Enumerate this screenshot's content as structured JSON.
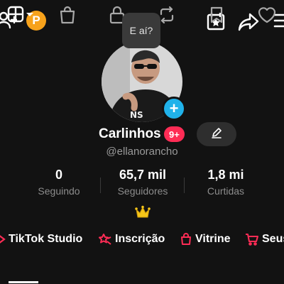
{
  "topbar": {
    "points_badge": "P",
    "icons": [
      "add-user-icon",
      "calendar-star-icon",
      "share-icon",
      "menu-icon"
    ]
  },
  "bubble": {
    "text": "E aí?"
  },
  "profile": {
    "name": "Carlinhos",
    "notifications": "9+",
    "username": "@ellanorancho"
  },
  "stats": [
    {
      "value": "0",
      "label": "Seguindo"
    },
    {
      "value": "65,7 mil",
      "label": "Seguidores"
    },
    {
      "value": "1,8 mi",
      "label": "Curtidas"
    }
  ],
  "shortcuts": [
    {
      "label": "TikTok Studio",
      "icon": "studio-icon"
    },
    {
      "label": "Inscrição",
      "icon": "subscription-icon"
    },
    {
      "label": "Vitrine",
      "icon": "shop-bag-icon"
    },
    {
      "label": "Seus",
      "icon": "cart-icon"
    }
  ],
  "tabs": [
    "grid-tab",
    "shop-tab",
    "private-tab",
    "reposts-tab",
    "favorites-tab",
    "liked-tab"
  ],
  "colors": {
    "accent": "#fe2c55",
    "blue": "#20b2ea",
    "gold": "#f7a21b",
    "background": "#121212"
  }
}
